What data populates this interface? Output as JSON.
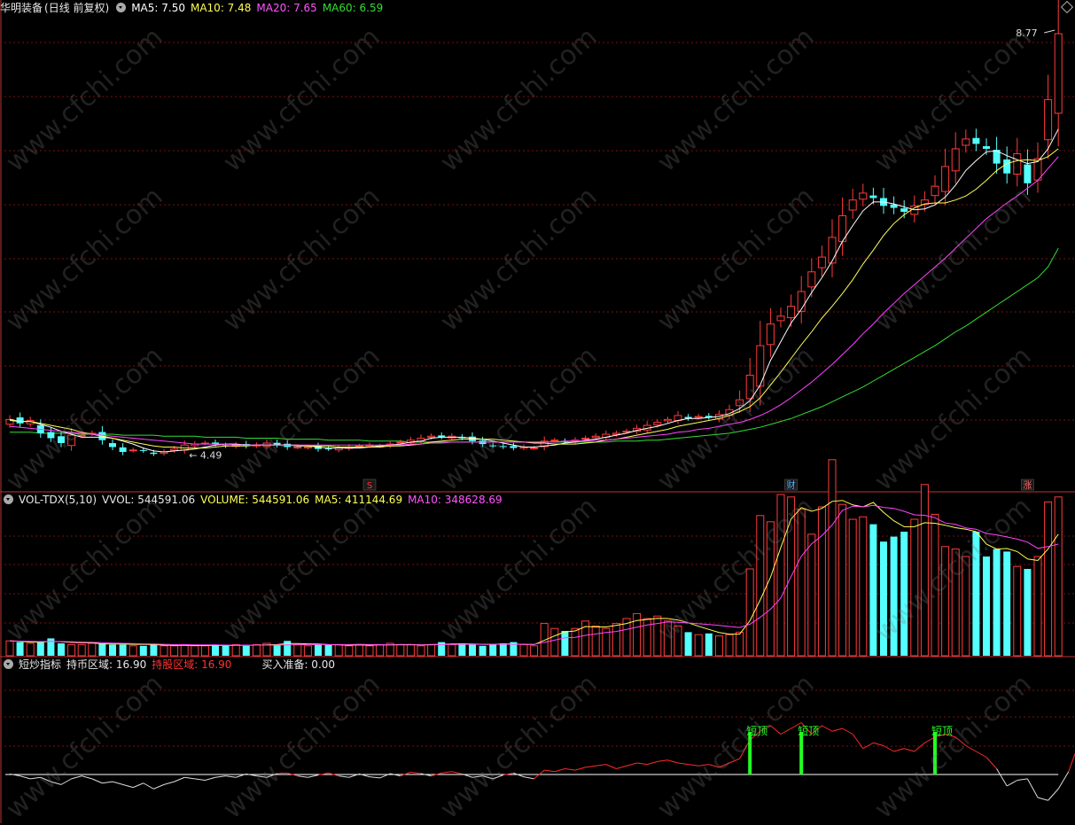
{
  "main_header": {
    "stock_name": "华明装备",
    "period": "(日线 前复权)",
    "ma5": "MA5: 7.50",
    "ma10": "MA10: 7.48",
    "ma20": "MA20: 7.65",
    "ma60": "MA60: 6.59"
  },
  "volume_header": {
    "indicator": "VOL-TDX(5,10)",
    "vvol": "VVOL: 544591.06",
    "volume": "VOLUME: 544591.06",
    "ma5": "MA5: 411144.69",
    "ma10": "MA10: 348628.69"
  },
  "signal_header": {
    "indicator": "短炒指标",
    "hold_coin": "持币区域: 16.90",
    "hold_stock": "持股区域: 16.90",
    "buy_ready": "买入准备: 0.00"
  },
  "markers": {
    "max_label": "8.77",
    "min_label": "4.49",
    "event_s": "S",
    "event_cai": "财",
    "event_zhang": "涨",
    "short_top": "短顶"
  },
  "watermark": "www.cfchi.com",
  "colors": {
    "up": "#ff3b3b",
    "down": "#54ffff",
    "ma5": "#ffffff",
    "ma10": "#ffff55",
    "ma20": "#ff44ff",
    "ma60": "#33dd33",
    "grid": "#7a1010",
    "signal_green": "#22ff22"
  },
  "chart_data": [
    {
      "type": "candlestick",
      "title": "华明装备 (日线 前复权)",
      "series": [
        {
          "name": "K线",
          "values": [
            4.85,
            4.81,
            4.84,
            4.71,
            4.66,
            4.61,
            4.69,
            4.69,
            4.71,
            4.64,
            4.57,
            4.52,
            4.54,
            4.53,
            4.5,
            4.52,
            4.55,
            4.59,
            4.6,
            4.61,
            4.6,
            4.58,
            4.59,
            4.58,
            4.59,
            4.61,
            4.59,
            4.57,
            4.57,
            4.57,
            4.55,
            4.55,
            4.56,
            4.57,
            4.58,
            4.59,
            4.58,
            4.6,
            4.62,
            4.64,
            4.66,
            4.68,
            4.67,
            4.68,
            4.66,
            4.63,
            4.6,
            4.58,
            4.57,
            4.56,
            4.57,
            4.56,
            4.63,
            4.64,
            4.63,
            4.64,
            4.66,
            4.68,
            4.7,
            4.71,
            4.73,
            4.76,
            4.79,
            4.82,
            4.85,
            4.89,
            4.86,
            4.88,
            4.87,
            4.9,
            4.95,
            5.05,
            5.3,
            5.6,
            5.82,
            5.9,
            6.0,
            6.15,
            6.35,
            6.5,
            6.7,
            6.92,
            7.08,
            7.15,
            7.1,
            7.02,
            7.0,
            6.96,
            7.02,
            7.08,
            7.22,
            7.42,
            7.6,
            7.7,
            7.65,
            7.6,
            7.45,
            7.35,
            7.55,
            7.25,
            7.5,
            8.1,
            8.77
          ]
        },
        {
          "name": "MA5",
          "values": [
            4.85,
            4.83,
            4.83,
            4.8,
            4.77,
            4.73,
            4.7,
            4.67,
            4.67,
            4.67,
            4.66,
            4.63,
            4.6,
            4.56,
            4.53,
            4.52,
            4.53,
            4.54,
            4.55,
            4.57,
            4.59,
            4.6,
            4.6,
            4.59,
            4.59,
            4.59,
            4.59,
            4.59,
            4.58,
            4.58,
            4.57,
            4.56,
            4.56,
            4.56,
            4.56,
            4.57,
            4.58,
            4.59,
            4.6,
            4.62,
            4.63,
            4.66,
            4.67,
            4.67,
            4.67,
            4.66,
            4.65,
            4.63,
            4.61,
            4.59,
            4.57,
            4.57,
            4.58,
            4.59,
            4.61,
            4.62,
            4.64,
            4.65,
            4.67,
            4.69,
            4.71,
            4.74,
            4.76,
            4.78,
            4.81,
            4.84,
            4.86,
            4.86,
            4.87,
            4.88,
            4.91,
            4.96,
            5.04,
            5.2,
            5.45,
            5.64,
            5.83,
            5.97,
            6.14,
            6.29,
            6.46,
            6.66,
            6.82,
            6.97,
            7.06,
            7.06,
            7.04,
            7.01,
            6.98,
            6.99,
            7.03,
            7.11,
            7.23,
            7.38,
            7.48,
            7.57,
            7.58,
            7.53,
            7.49,
            7.45,
            7.47,
            7.6,
            7.8
          ]
        },
        {
          "name": "MA10",
          "values": [
            4.84,
            4.83,
            4.83,
            4.81,
            4.79,
            4.77,
            4.75,
            4.72,
            4.7,
            4.68,
            4.66,
            4.64,
            4.62,
            4.6,
            4.58,
            4.57,
            4.57,
            4.56,
            4.56,
            4.56,
            4.57,
            4.58,
            4.58,
            4.58,
            4.59,
            4.59,
            4.59,
            4.59,
            4.59,
            4.58,
            4.58,
            4.58,
            4.57,
            4.57,
            4.57,
            4.57,
            4.57,
            4.58,
            4.58,
            4.59,
            4.6,
            4.62,
            4.63,
            4.64,
            4.65,
            4.65,
            4.65,
            4.65,
            4.64,
            4.63,
            4.62,
            4.61,
            4.61,
            4.6,
            4.6,
            4.6,
            4.61,
            4.62,
            4.64,
            4.65,
            4.67,
            4.69,
            4.71,
            4.73,
            4.75,
            4.78,
            4.8,
            4.82,
            4.84,
            4.86,
            4.89,
            4.93,
            4.98,
            5.07,
            5.2,
            5.33,
            5.47,
            5.61,
            5.74,
            5.88,
            6.0,
            6.13,
            6.27,
            6.43,
            6.57,
            6.72,
            6.84,
            6.93,
            7.0,
            7.04,
            7.05,
            7.05,
            7.08,
            7.12,
            7.19,
            7.28,
            7.38,
            7.45,
            7.48,
            7.49,
            7.48,
            7.52,
            7.6
          ]
        },
        {
          "name": "MA20",
          "values": [
            4.78,
            4.77,
            4.76,
            4.75,
            4.74,
            4.73,
            4.72,
            4.71,
            4.7,
            4.69,
            4.68,
            4.67,
            4.66,
            4.65,
            4.64,
            4.63,
            4.62,
            4.61,
            4.6,
            4.6,
            4.6,
            4.6,
            4.59,
            4.59,
            4.59,
            4.59,
            4.59,
            4.59,
            4.59,
            4.59,
            4.59,
            4.59,
            4.59,
            4.59,
            4.59,
            4.59,
            4.59,
            4.59,
            4.59,
            4.6,
            4.6,
            4.61,
            4.61,
            4.62,
            4.62,
            4.62,
            4.62,
            4.62,
            4.62,
            4.62,
            4.62,
            4.62,
            4.62,
            4.62,
            4.63,
            4.63,
            4.63,
            4.64,
            4.64,
            4.65,
            4.66,
            4.67,
            4.68,
            4.69,
            4.7,
            4.72,
            4.73,
            4.75,
            4.76,
            4.78,
            4.8,
            4.82,
            4.85,
            4.89,
            4.94,
            5.0,
            5.07,
            5.15,
            5.23,
            5.32,
            5.41,
            5.51,
            5.61,
            5.72,
            5.82,
            5.93,
            6.03,
            6.13,
            6.22,
            6.31,
            6.4,
            6.49,
            6.59,
            6.69,
            6.79,
            6.89,
            6.97,
            7.05,
            7.12,
            7.2,
            7.28,
            7.4,
            7.52
          ]
        },
        {
          "name": "MA60",
          "values": [
            4.72,
            4.72,
            4.72,
            4.71,
            4.71,
            4.71,
            4.71,
            4.7,
            4.7,
            4.7,
            4.7,
            4.69,
            4.69,
            4.69,
            4.69,
            4.68,
            4.68,
            4.68,
            4.68,
            4.67,
            4.67,
            4.67,
            4.67,
            4.66,
            4.66,
            4.66,
            4.66,
            4.65,
            4.65,
            4.65,
            4.65,
            4.64,
            4.64,
            4.64,
            4.64,
            4.63,
            4.63,
            4.63,
            4.63,
            4.62,
            4.62,
            4.62,
            4.62,
            4.62,
            4.62,
            4.62,
            4.62,
            4.62,
            4.62,
            4.62,
            4.62,
            4.62,
            4.62,
            4.62,
            4.62,
            4.62,
            4.62,
            4.62,
            4.62,
            4.63,
            4.63,
            4.63,
            4.64,
            4.64,
            4.65,
            4.66,
            4.67,
            4.68,
            4.69,
            4.7,
            4.71,
            4.73,
            4.75,
            4.77,
            4.8,
            4.83,
            4.86,
            4.9,
            4.94,
            4.98,
            5.03,
            5.08,
            5.13,
            5.18,
            5.24,
            5.3,
            5.36,
            5.42,
            5.48,
            5.54,
            5.6,
            5.67,
            5.74,
            5.8,
            5.87,
            5.94,
            6.01,
            6.08,
            6.15,
            6.22,
            6.29,
            6.4,
            6.59
          ]
        }
      ],
      "ylim": [
        4.25,
        8.95
      ]
    },
    {
      "type": "bar",
      "title": "VOL-TDX(5,10)",
      "values": [
        60,
        55,
        50,
        55,
        70,
        50,
        45,
        45,
        50,
        50,
        45,
        45,
        40,
        40,
        45,
        40,
        40,
        45,
        40,
        40,
        45,
        40,
        45,
        40,
        45,
        50,
        45,
        60,
        45,
        40,
        45,
        45,
        45,
        40,
        45,
        40,
        45,
        50,
        45,
        45,
        40,
        45,
        55,
        45,
        50,
        45,
        40,
        45,
        50,
        55,
        45,
        40,
        130,
        110,
        100,
        110,
        140,
        120,
        110,
        130,
        150,
        170,
        150,
        160,
        140,
        120,
        95,
        85,
        90,
        80,
        85,
        95,
        350,
        565,
        540,
        650,
        640,
        590,
        490,
        600,
        790,
        610,
        550,
        560,
        530,
        460,
        480,
        500,
        550,
        690,
        570,
        440,
        430,
        400,
        500,
        400,
        430,
        420,
        360,
        350,
        400,
        620,
        640
      ],
      "series": [
        {
          "name": "MA5",
          "values": [
            60,
            58,
            55,
            55,
            58,
            56,
            54,
            53,
            52,
            48,
            47,
            47,
            46,
            46,
            45,
            43,
            42,
            42,
            41,
            41,
            42,
            41,
            42,
            42,
            43,
            44,
            45,
            49,
            49,
            48,
            47,
            45,
            44,
            43,
            44,
            43,
            44,
            44,
            45,
            45,
            44,
            45,
            46,
            47,
            48,
            47,
            46,
            46,
            47,
            47,
            46,
            45,
            62,
            80,
            96,
            100,
            118,
            116,
            116,
            122,
            130,
            142,
            146,
            151,
            150,
            144,
            133,
            119,
            106,
            94,
            87,
            87,
            141,
            225,
            316,
            436,
            551,
            597,
            582,
            594,
            622,
            626,
            608,
            600,
            618,
            578,
            544,
            520,
            520,
            536,
            534,
            526,
            516,
            510,
            500,
            450,
            430,
            432,
            420,
            390,
            384,
            430,
            490
          ]
        },
        {
          "name": "MA10",
          "values": [
            60,
            59,
            58,
            57,
            58,
            57,
            56,
            55,
            54,
            53,
            51,
            50,
            49,
            48,
            47,
            46,
            45,
            45,
            44,
            44,
            44,
            43,
            43,
            43,
            43,
            43,
            43,
            44,
            44,
            45,
            45,
            45,
            45,
            45,
            46,
            45,
            45,
            44,
            44,
            44,
            44,
            44,
            45,
            45,
            46,
            46,
            46,
            46,
            46,
            46,
            46,
            46,
            54,
            63,
            72,
            74,
            82,
            88,
            94,
            98,
            106,
            115,
            124,
            130,
            136,
            135,
            132,
            129,
            126,
            122,
            118,
            114,
            127,
            155,
            187,
            233,
            319,
            401,
            451,
            484,
            527,
            586,
            603,
            600,
            606,
            598,
            594,
            582,
            568,
            566,
            556,
            535,
            530,
            515,
            510,
            493,
            487,
            479,
            470,
            458,
            433,
            440,
            450
          ]
        }
      ]
    },
    {
      "type": "line",
      "title": "短炒指标",
      "series": [
        {
          "name": "持股区域",
          "values": [
            0.2,
            -0.5,
            -1.5,
            -1.0,
            -2.5,
            -3.5,
            -1.5,
            -0.5,
            -1.5,
            -3.0,
            -2.5,
            -3.5,
            -4.5,
            -3.0,
            -5.0,
            -3.5,
            -2.5,
            -1.0,
            -1.5,
            -2.0,
            -1.0,
            -0.5,
            -1.0,
            0.2,
            -0.5,
            -1.0,
            0.3,
            0.5,
            -0.5,
            -1.0,
            -0.2,
            0.5,
            -0.5,
            -1.0,
            0.2,
            -0.8,
            -1.2,
            0.3,
            -0.5,
            0.8,
            0.3,
            -0.5,
            0.5,
            1.0,
            0.2,
            -1.0,
            -0.5,
            -1.5,
            -0.2,
            0.5,
            -0.8,
            -1.5,
            1.5,
            1.0,
            2.0,
            1.5,
            2.5,
            3.0,
            3.5,
            2.0,
            3.0,
            4.0,
            3.5,
            4.5,
            5.0,
            4.0,
            3.5,
            3.0,
            3.5,
            2.5,
            4.0,
            5.5,
            12.0,
            15.0,
            17.0,
            14.0,
            16.0,
            18.0,
            14.0,
            17.0,
            15.0,
            16.0,
            14.0,
            9.0,
            11.0,
            10.0,
            8.0,
            9.0,
            8.0,
            11.0,
            13.0,
            14.0,
            13.0,
            10.0,
            8.0,
            6.0,
            2.0,
            -4.0,
            -2.0,
            -1.5,
            -8.0,
            -9.0,
            -5.0,
            1.0,
            11.0
          ]
        }
      ],
      "annotations": [
        "短顶",
        "短顶",
        "短顶"
      ]
    }
  ]
}
